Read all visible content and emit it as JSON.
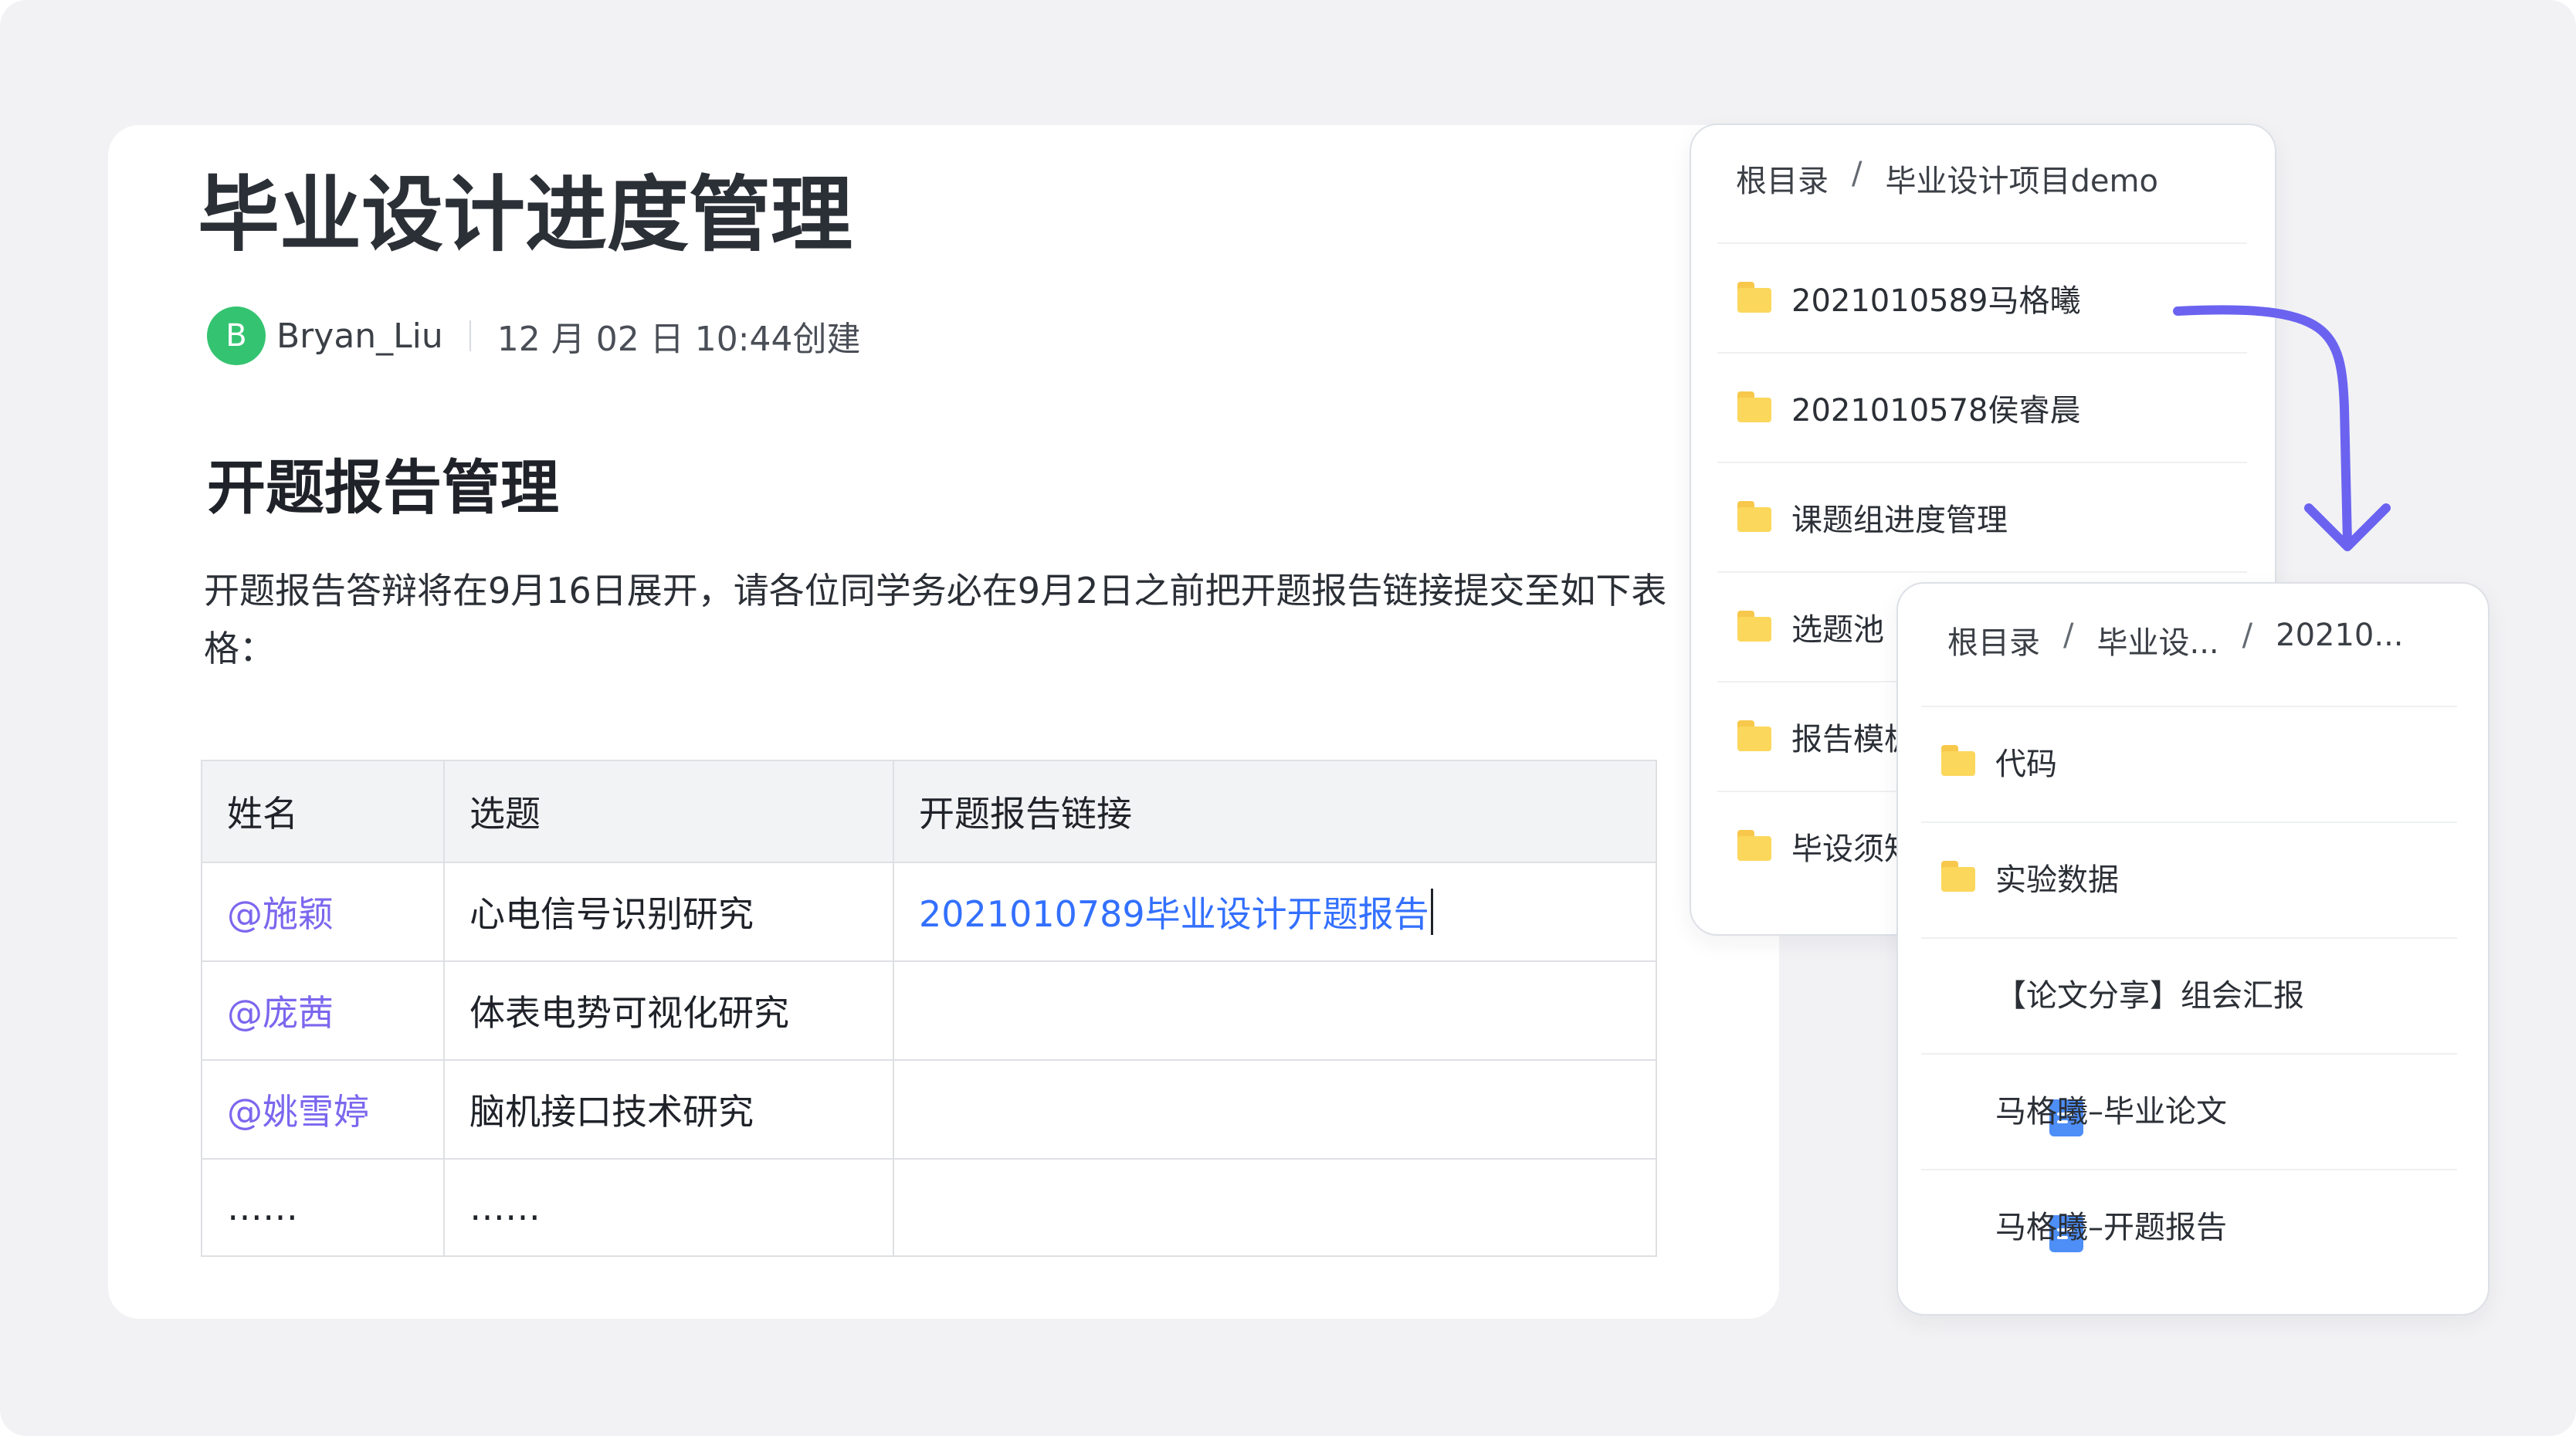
{
  "doc": {
    "title": "毕业设计进度管理",
    "author": {
      "initial": "B",
      "name": "Bryan_Liu"
    },
    "created": "12 月 02 日 10:44创建",
    "section_title": "开题报告管理",
    "paragraph": "开题报告答辩将在9月16日展开，请各位同学务必在9月2日之前把开题报告链接提交至如下表格：",
    "table": {
      "headers": [
        "姓名",
        "选题",
        "开题报告链接"
      ],
      "rows": [
        {
          "name": "@施颖",
          "topic": "心电信号识别研究",
          "link": "2021010789毕业设计开题报告"
        },
        {
          "name": "@庞茜",
          "topic": "体表电势可视化研究",
          "link": ""
        },
        {
          "name": "@姚雪婷",
          "topic": "脑机接口技术研究",
          "link": ""
        },
        {
          "name": "……",
          "topic": "……",
          "link": ""
        }
      ]
    }
  },
  "panel_root": {
    "breadcrumb": [
      "根目录",
      "/",
      "毕业设计项目demo"
    ],
    "items": [
      {
        "type": "folder",
        "name": "2021010589马格曦"
      },
      {
        "type": "folder",
        "name": "2021010578侯睿晨"
      },
      {
        "type": "folder",
        "name": "课题组进度管理"
      },
      {
        "type": "folder",
        "name": "选题池"
      },
      {
        "type": "folder",
        "name": "报告模板"
      },
      {
        "type": "folder",
        "name": "毕设须知"
      }
    ]
  },
  "panel_sub": {
    "breadcrumb": [
      "根目录",
      "/",
      "毕业设...",
      "/",
      "20210..."
    ],
    "items": [
      {
        "type": "folder",
        "name": "代码"
      },
      {
        "type": "folder",
        "name": "实验数据"
      },
      {
        "type": "doc",
        "name": "【论文分享】组会汇报"
      },
      {
        "type": "doc",
        "name": "马格曦–毕业论文"
      },
      {
        "type": "doc",
        "name": "马格曦–开题报告"
      }
    ]
  },
  "colors": {
    "background": "#f2f2f4",
    "avatar": "#34c471",
    "mention": "#7b67ee",
    "link": "#3370ff",
    "folder": "#fbd75c",
    "doc_icon": "#4d8ef7",
    "arrow": "#6b63f0"
  }
}
